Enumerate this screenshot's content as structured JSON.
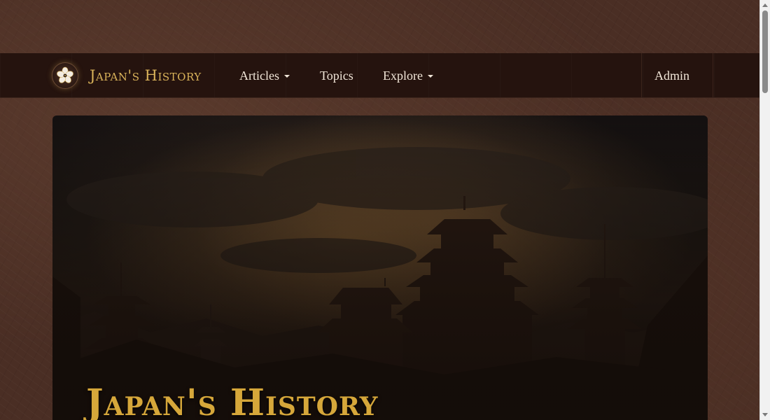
{
  "navbar": {
    "brand": {
      "title": "Japan's History",
      "logo_icon": "sakura-crest-icon"
    },
    "items": [
      {
        "label": "Articles",
        "dropdown": true
      },
      {
        "label": "Topics",
        "dropdown": false
      },
      {
        "label": "Explore",
        "dropdown": true
      }
    ],
    "admin_label": "Admin"
  },
  "hero": {
    "title": "Japan's History",
    "image_icon": "japanese-castle-silhouette-image"
  },
  "colors": {
    "navbar_bg": "#25130e",
    "brand_gold": "#d9b35a",
    "nav_text": "#f1e6d8",
    "hero_title": "#d6a73a",
    "page_bg": "#4a2e24"
  }
}
